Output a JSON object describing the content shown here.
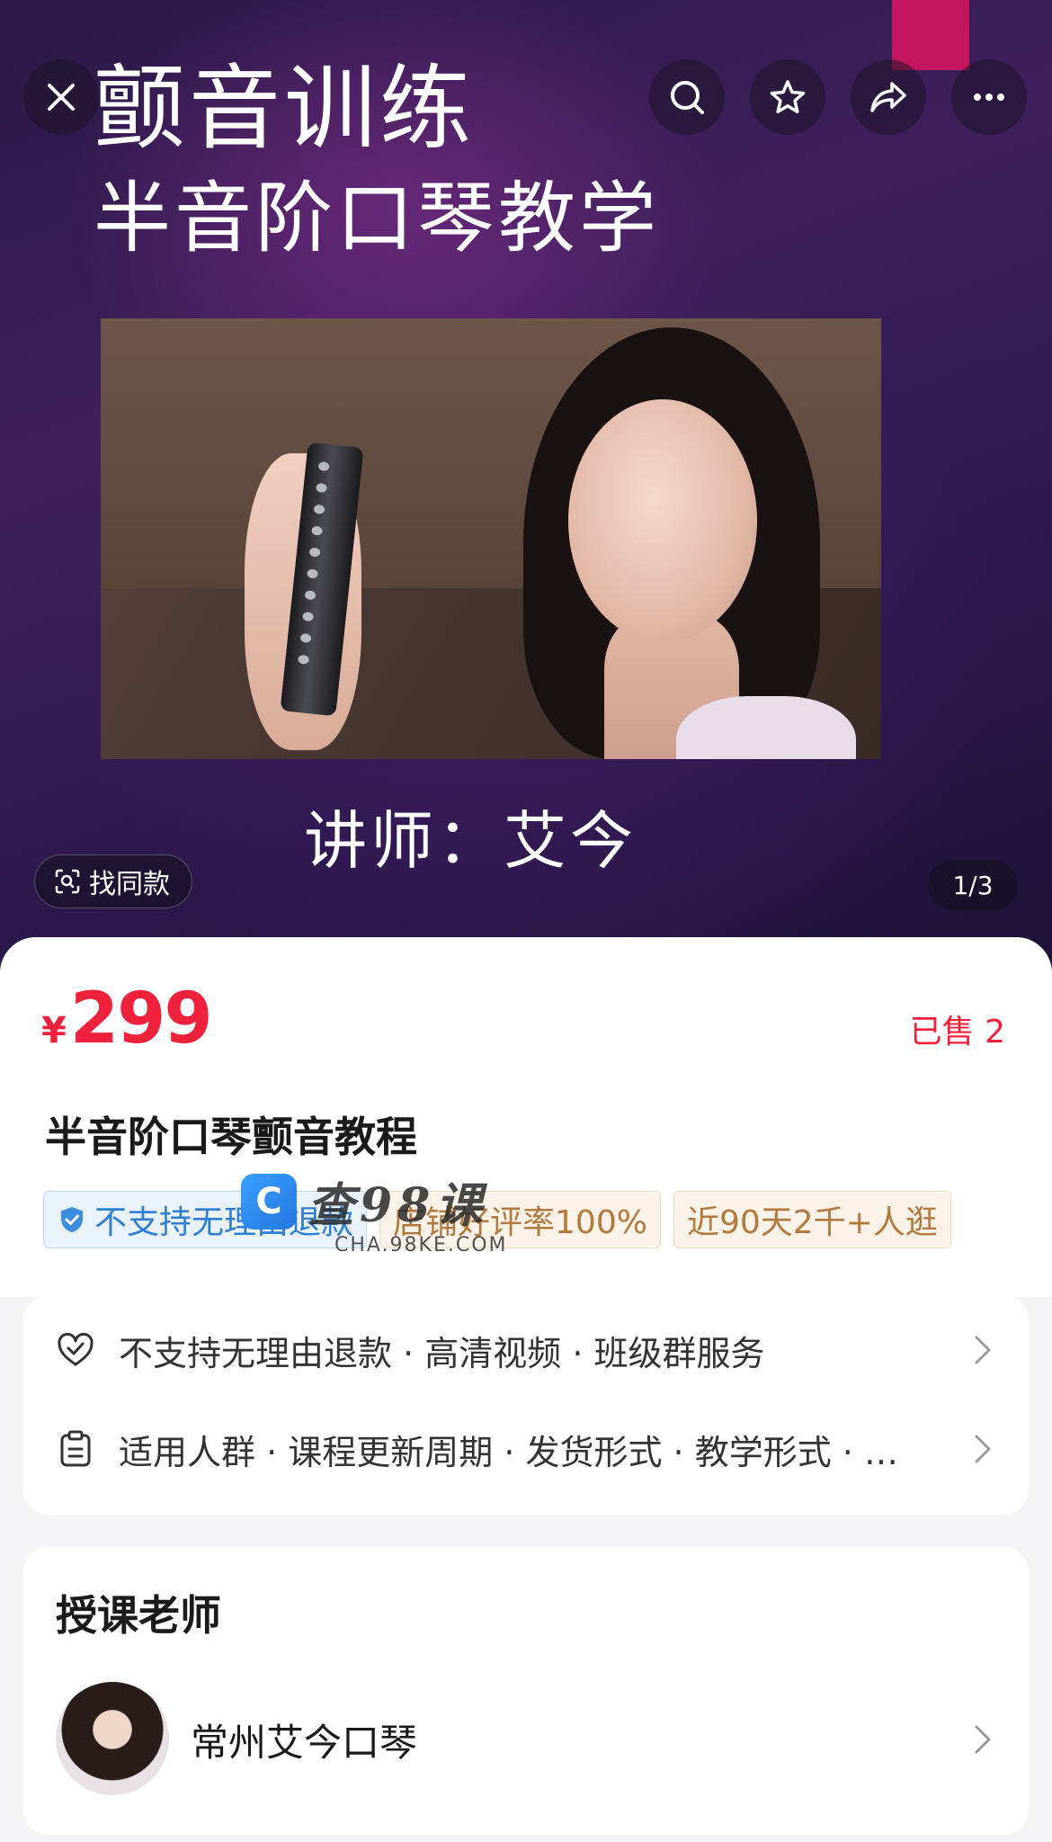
{
  "hero": {
    "title": "颤音训练",
    "subtitle": "半音阶口琴教学",
    "lecturer": "讲师：艾今",
    "find_same_label": "找同款",
    "pager": "1/3"
  },
  "product": {
    "currency": "¥",
    "price": "299",
    "sold": "已售 2",
    "title": "半音阶口琴颤音教程",
    "tags": [
      {
        "label": "不支持无理由退款",
        "style": "blue"
      },
      {
        "label": "店铺好评率100%",
        "style": "gold"
      },
      {
        "label": "近90天2千+人逛",
        "style": "gold"
      }
    ]
  },
  "watermark": {
    "logo": "C",
    "text": "查98课",
    "url": "CHA.98KE.COM"
  },
  "services": {
    "row1": "不支持无理由退款 · 高清视频 · 班级群服务",
    "row2": "适用人群 · 课程更新周期 · 发货形式 · 教学形式 · …"
  },
  "teacher": {
    "heading": "授课老师",
    "name": "常州艾今口琴"
  },
  "icons": {
    "close": "close-icon",
    "search": "search-icon",
    "favorite": "star-icon",
    "share": "share-icon",
    "more": "more-icon",
    "find_same": "scan-icon",
    "tag_shield": "shield-check-icon",
    "service": "heart-shield-icon",
    "params": "clipboard-icon",
    "chevron": "chevron-right-icon"
  },
  "colors": {
    "price_red": "#f0213c",
    "tag_blue": "#2f7fd4",
    "tag_gold": "#b27a3e",
    "hero_accent": "#c4175f"
  }
}
